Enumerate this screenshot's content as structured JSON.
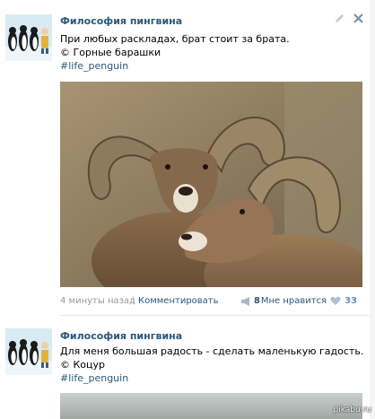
{
  "posts": [
    {
      "author": "Философия пингвина",
      "lines": [
        "При любых раскладах, брат стоит за брата.",
        "© Горные барашки"
      ],
      "hashtag": "#life_penguin",
      "time": "4 минуты назад",
      "separator": "|",
      "comment_label": "Комментировать",
      "share_count": "8",
      "like_label": "Мне нравится",
      "like_count": "33"
    },
    {
      "author": "Философия пингвина",
      "lines": [
        "Для меня большая радость - сделать маленькую гадость.",
        "© Коцур"
      ],
      "hashtag": "#life_penguin"
    }
  ],
  "watermark": "pikabu.ru",
  "colors": {
    "link": "#2b587a",
    "meta": "#999999",
    "like": "#6c8fb3"
  },
  "icons": [
    "penguin-avatar-icon",
    "pencil-edit-icon",
    "close-icon",
    "megaphone-share-icon",
    "heart-icon"
  ]
}
